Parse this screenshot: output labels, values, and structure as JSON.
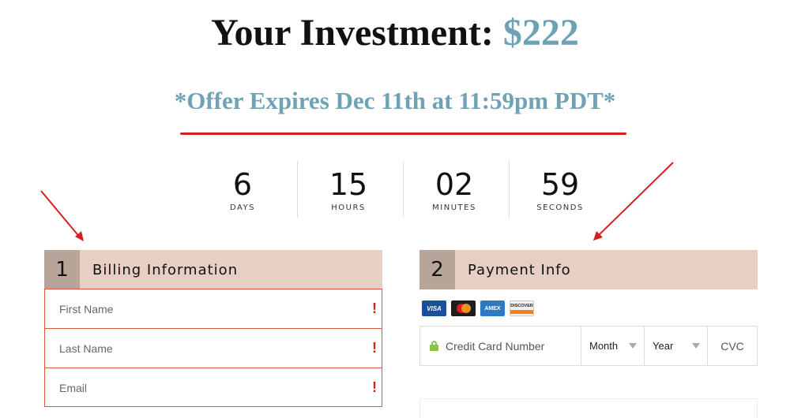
{
  "headline": {
    "prefix": "Your Investment: ",
    "amount": "$222"
  },
  "offer": {
    "text": "*Offer Expires Dec 11th at 11:59pm PDT*"
  },
  "countdown": [
    {
      "value": "6",
      "unit": "DAYS"
    },
    {
      "value": "15",
      "unit": "HOURS"
    },
    {
      "value": "02",
      "unit": "MINUTES"
    },
    {
      "value": "59",
      "unit": "SECONDS"
    }
  ],
  "billing": {
    "step": "1",
    "title": "Billing Information",
    "fields": [
      {
        "placeholder": "First Name",
        "value": "",
        "warning": "!"
      },
      {
        "placeholder": "Last Name",
        "value": "",
        "warning": "!"
      },
      {
        "placeholder": "Email",
        "value": "",
        "warning": "!"
      }
    ]
  },
  "payment": {
    "step": "2",
    "title": "Payment Info",
    "cards": [
      "VISA",
      "mastercard",
      "AMEX",
      "DISCOVER"
    ],
    "cc_placeholder": "Credit Card Number",
    "month_label": "Month",
    "year_label": "Year",
    "cvc_placeholder": "CVC"
  },
  "colors": {
    "accent": "#6fa2b4",
    "header_bg": "#e8cfc3",
    "step_bg": "#b8a498",
    "error": "#d62020"
  }
}
